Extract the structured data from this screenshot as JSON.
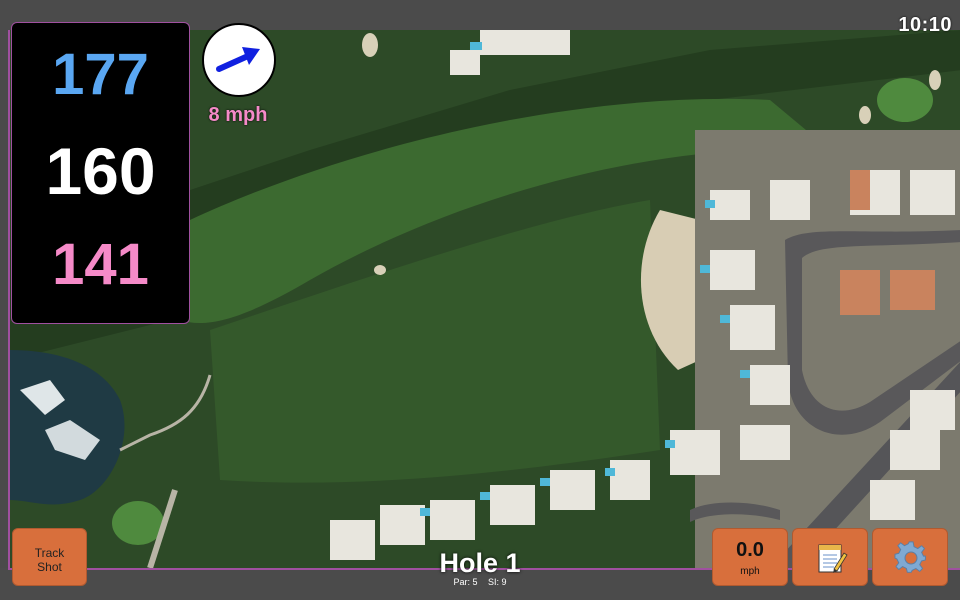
{
  "status": {
    "clock": "10:10"
  },
  "yardage": {
    "back": "177",
    "middle": "160",
    "front": "141"
  },
  "wind": {
    "speed": "8 mph",
    "arrow_color": "#1020e0"
  },
  "hole": {
    "title": "Hole 1",
    "par": "Par: 5",
    "si": "SI: 9"
  },
  "buttons": {
    "track_shot_line1": "Track",
    "track_shot_line2": "Shot",
    "speed_value": "0.0",
    "speed_unit": "mph",
    "notes_icon": "notepad-icon",
    "settings_icon": "gear-icon"
  },
  "colors": {
    "back_yardage": "#5aa7f2",
    "middle_yardage": "#ffffff",
    "front_yardage": "#f58ac8",
    "button_orange": "#d86f3c",
    "accent_purple": "#a050a0"
  }
}
